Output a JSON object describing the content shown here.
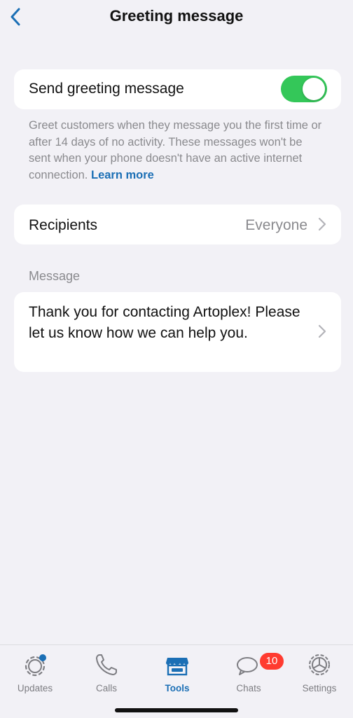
{
  "nav": {
    "title": "Greeting message",
    "back_icon": "chevron-left-icon"
  },
  "greeting": {
    "toggle_label": "Send greeting message",
    "enabled": true,
    "helper_text": "Greet customers when they message you the first time or after 14 days of no activity. These messages won't be sent when your phone doesn't have an active internet connection.",
    "learn_more": "Learn more"
  },
  "recipients": {
    "label": "Recipients",
    "value": "Everyone"
  },
  "message": {
    "section_label": "Message",
    "text": "Thank you for contacting Artoplex! Please let us know how we can help you."
  },
  "tabbar": {
    "tabs": [
      {
        "label": "Updates",
        "icon": "updates-icon"
      },
      {
        "label": "Calls",
        "icon": "phone-icon"
      },
      {
        "label": "Tools",
        "icon": "storefront-icon",
        "active": true
      },
      {
        "label": "Chats",
        "icon": "chat-bubbles-icon",
        "badge": "10"
      },
      {
        "label": "Settings",
        "icon": "gear-icon"
      }
    ]
  },
  "colors": {
    "accent": "#1b6fb5",
    "toggle_on": "#34c759",
    "badge": "#ff3b30",
    "background": "#f2f1f6"
  }
}
